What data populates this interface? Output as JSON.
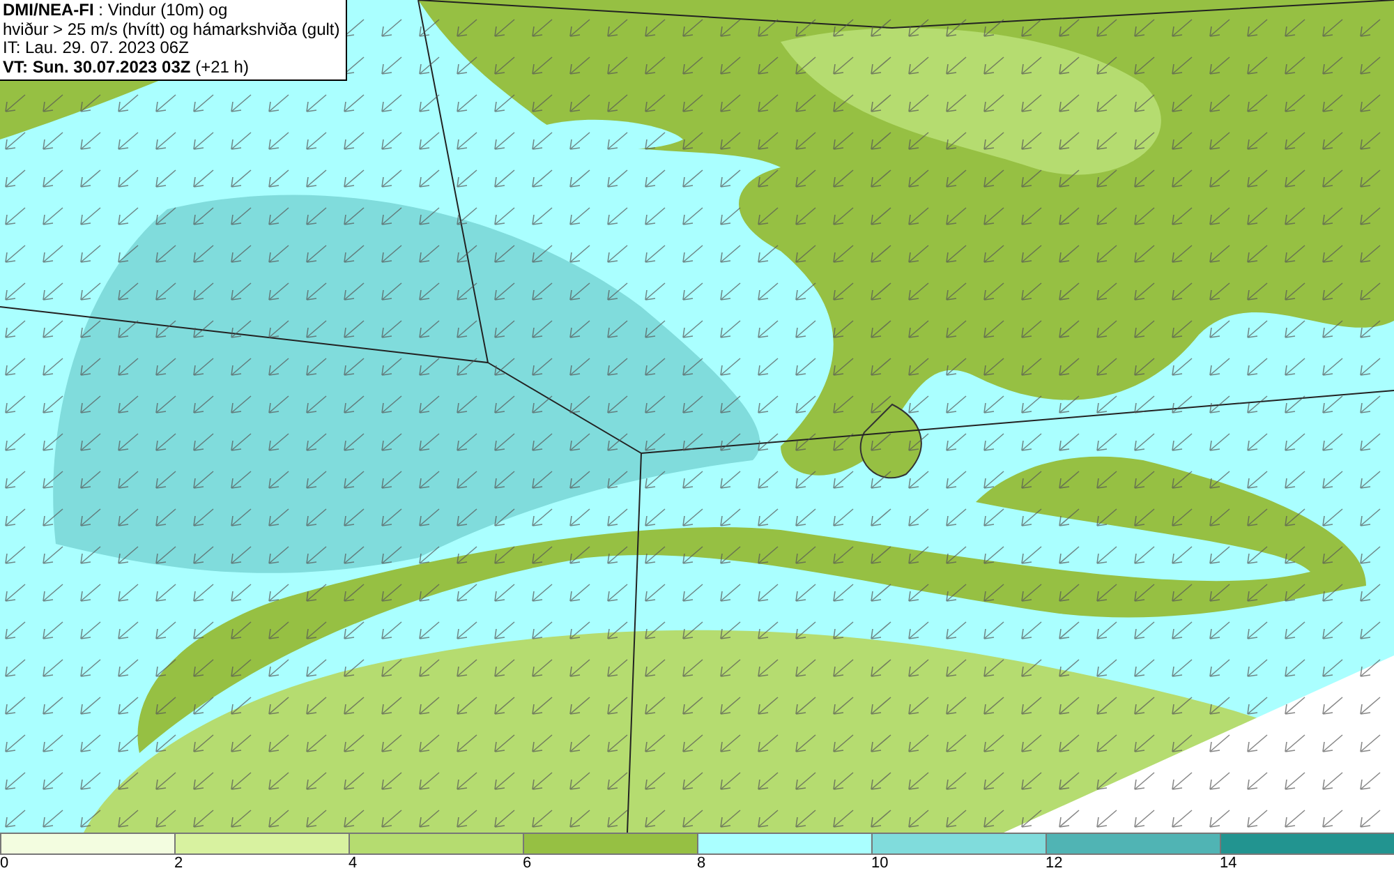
{
  "header": {
    "lines": [
      "**DMI/NEA-FI** : Vindur (10m) og",
      "hviður > 25 m/s (hvítt) og hámarkshviða (gult)",
      "IT: Lau. 29. 07. 2023 06Z",
      "**VT: Sun. 30.07.2023 03Z** (+21 h)"
    ]
  },
  "legend": [
    {
      "label": "0",
      "color": "#f3fde0"
    },
    {
      "label": "2",
      "color": "#d8f2a0"
    },
    {
      "label": "4",
      "color": "#b5dc70"
    },
    {
      "label": "6",
      "color": "#96c043"
    },
    {
      "label": "8",
      "color": "#aaffff"
    },
    {
      "label": "10",
      "color": "#80dcdc"
    },
    {
      "label": "12",
      "color": "#50b4b4"
    },
    {
      "label": "14",
      "color": "#229490"
    }
  ]
}
